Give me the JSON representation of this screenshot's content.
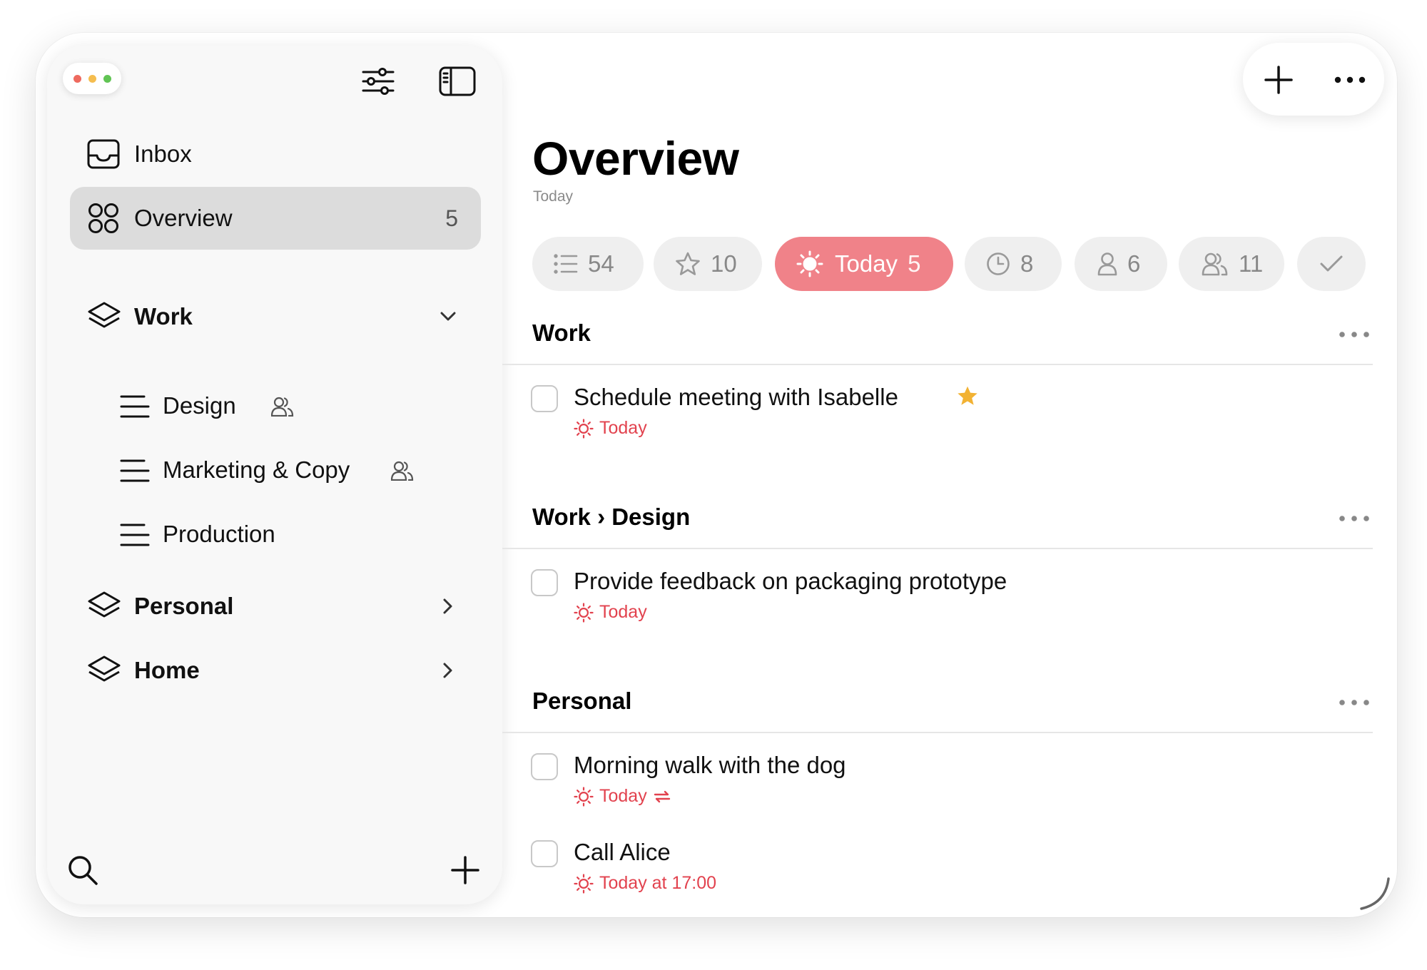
{
  "colors": {
    "accent": "#f08289",
    "due_red": "#e2424e",
    "star": "#f2b233",
    "traffic_red": "#ee6a5f",
    "traffic_yellow": "#f5bd4f",
    "traffic_green": "#61c454"
  },
  "toolbar": {
    "filter_icon": "sliders-icon",
    "sidebar_toggle_icon": "sidebar-toggle-icon",
    "add_icon": "plus-icon",
    "more_icon": "ellipsis-icon"
  },
  "sidebar": {
    "inbox": {
      "label": "Inbox",
      "icon": "tray-icon"
    },
    "overview": {
      "label": "Overview",
      "count": "5",
      "icon": "grid-circles-icon"
    },
    "areas": [
      {
        "label": "Work",
        "expanded": true,
        "lists": [
          {
            "label": "Design",
            "shared": true
          },
          {
            "label": "Marketing & Copy",
            "shared": true
          },
          {
            "label": "Production",
            "shared": false
          }
        ]
      },
      {
        "label": "Personal",
        "expanded": false
      },
      {
        "label": "Home",
        "expanded": false
      }
    ],
    "search_icon": "search-icon",
    "add_icon": "plus-icon"
  },
  "main": {
    "title": "Overview",
    "subtitle": "Today",
    "filters": [
      {
        "icon": "list-icon",
        "count": "54"
      },
      {
        "icon": "star-icon",
        "count": "10"
      },
      {
        "icon": "sun-icon",
        "label": "Today",
        "count": "5",
        "active": true
      },
      {
        "icon": "clock-icon",
        "count": "8"
      },
      {
        "icon": "person-icon",
        "count": "6"
      },
      {
        "icon": "people-icon",
        "count": "11"
      },
      {
        "icon": "checkmark-icon"
      }
    ],
    "sections": [
      {
        "title": "Work",
        "tasks": [
          {
            "title": "Schedule meeting with Isabelle",
            "starred": true,
            "due": "Today"
          }
        ]
      },
      {
        "title": "Work › Design",
        "tasks": [
          {
            "title": "Provide feedback on packaging prototype",
            "due": "Today"
          }
        ]
      },
      {
        "title": "Personal",
        "tasks": [
          {
            "title": "Morning walk with the dog",
            "due": "Today",
            "repeats": true
          },
          {
            "title": "Call Alice",
            "due": "Today at 17:00"
          }
        ]
      }
    ]
  }
}
